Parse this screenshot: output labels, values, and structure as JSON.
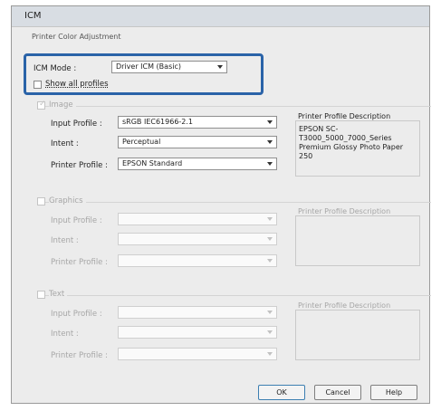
{
  "window": {
    "title": "ICM"
  },
  "group_label": "Printer Color Adjustment",
  "icm_mode": {
    "label": "ICM Mode :",
    "value": "Driver ICM (Basic)"
  },
  "show_all_profiles": {
    "label": "Show all profiles"
  },
  "image": {
    "label": "Image",
    "input_profile": {
      "label": "Input Profile :",
      "value": "sRGB IEC61966-2.1"
    },
    "intent": {
      "label": "Intent :",
      "value": "Perceptual"
    },
    "printer_profile": {
      "label": "Printer Profile :",
      "value": "EPSON Standard"
    },
    "description_title": "Printer Profile Description",
    "description_text": "EPSON SC-T3000_5000_7000_Series Premium Glossy Photo Paper 250"
  },
  "graphics": {
    "label": "Graphics",
    "input_profile_label": "Input Profile :",
    "intent_label": "Intent :",
    "printer_profile_label": "Printer Profile :",
    "description_title": "Printer Profile Description"
  },
  "text": {
    "label": "Text",
    "input_profile_label": "Input Profile :",
    "intent_label": "Intent :",
    "printer_profile_label": "Printer Profile :",
    "description_title": "Printer Profile Description"
  },
  "buttons": {
    "ok": "OK",
    "cancel": "Cancel",
    "help": "Help"
  },
  "colors": {
    "highlight": "#2a63a8"
  }
}
